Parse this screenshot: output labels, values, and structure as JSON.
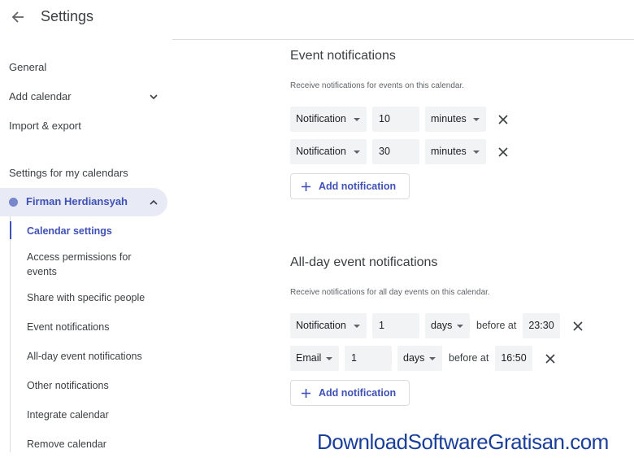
{
  "header": {
    "title": "Settings"
  },
  "sidebar": {
    "general": "General",
    "add_calendar": "Add calendar",
    "import_export": "Import & export",
    "section_title": "Settings for my calendars",
    "calendar_name": "Firman Herdiansyah",
    "sub_items": [
      "Calendar settings",
      "Access permissions for events",
      "Share with specific people",
      "Event notifications",
      "All-day event notifications",
      "Other notifications",
      "Integrate calendar",
      "Remove calendar"
    ]
  },
  "event_notifications": {
    "title": "Event notifications",
    "description": "Receive notifications for events on this calendar.",
    "rows": [
      {
        "type": "Notification",
        "value": "10",
        "unit": "minutes"
      },
      {
        "type": "Notification",
        "value": "30",
        "unit": "minutes"
      }
    ],
    "add_label": "Add notification"
  },
  "allday_notifications": {
    "title": "All-day event notifications",
    "description": "Receive notifications for all day events on this calendar.",
    "rows": [
      {
        "type": "Notification",
        "value": "1",
        "unit": "days",
        "before_at": "before at",
        "time": "23:30"
      },
      {
        "type": "Email",
        "value": "1",
        "unit": "days",
        "before_at": "before at",
        "time": "16:50"
      }
    ],
    "add_label": "Add notification"
  },
  "watermark": "DownloadSoftwareGratisan.com",
  "colors": {
    "accent": "#3f51b5",
    "calendar_dot": "#7986cb",
    "selected_bg": "#e8eaf6",
    "field_bg": "#f1f3f4"
  },
  "icons": {
    "back": "arrow-back-icon",
    "expand": "chevron-down-icon",
    "collapse": "chevron-up-icon",
    "remove": "close-icon",
    "add": "plus-icon"
  }
}
